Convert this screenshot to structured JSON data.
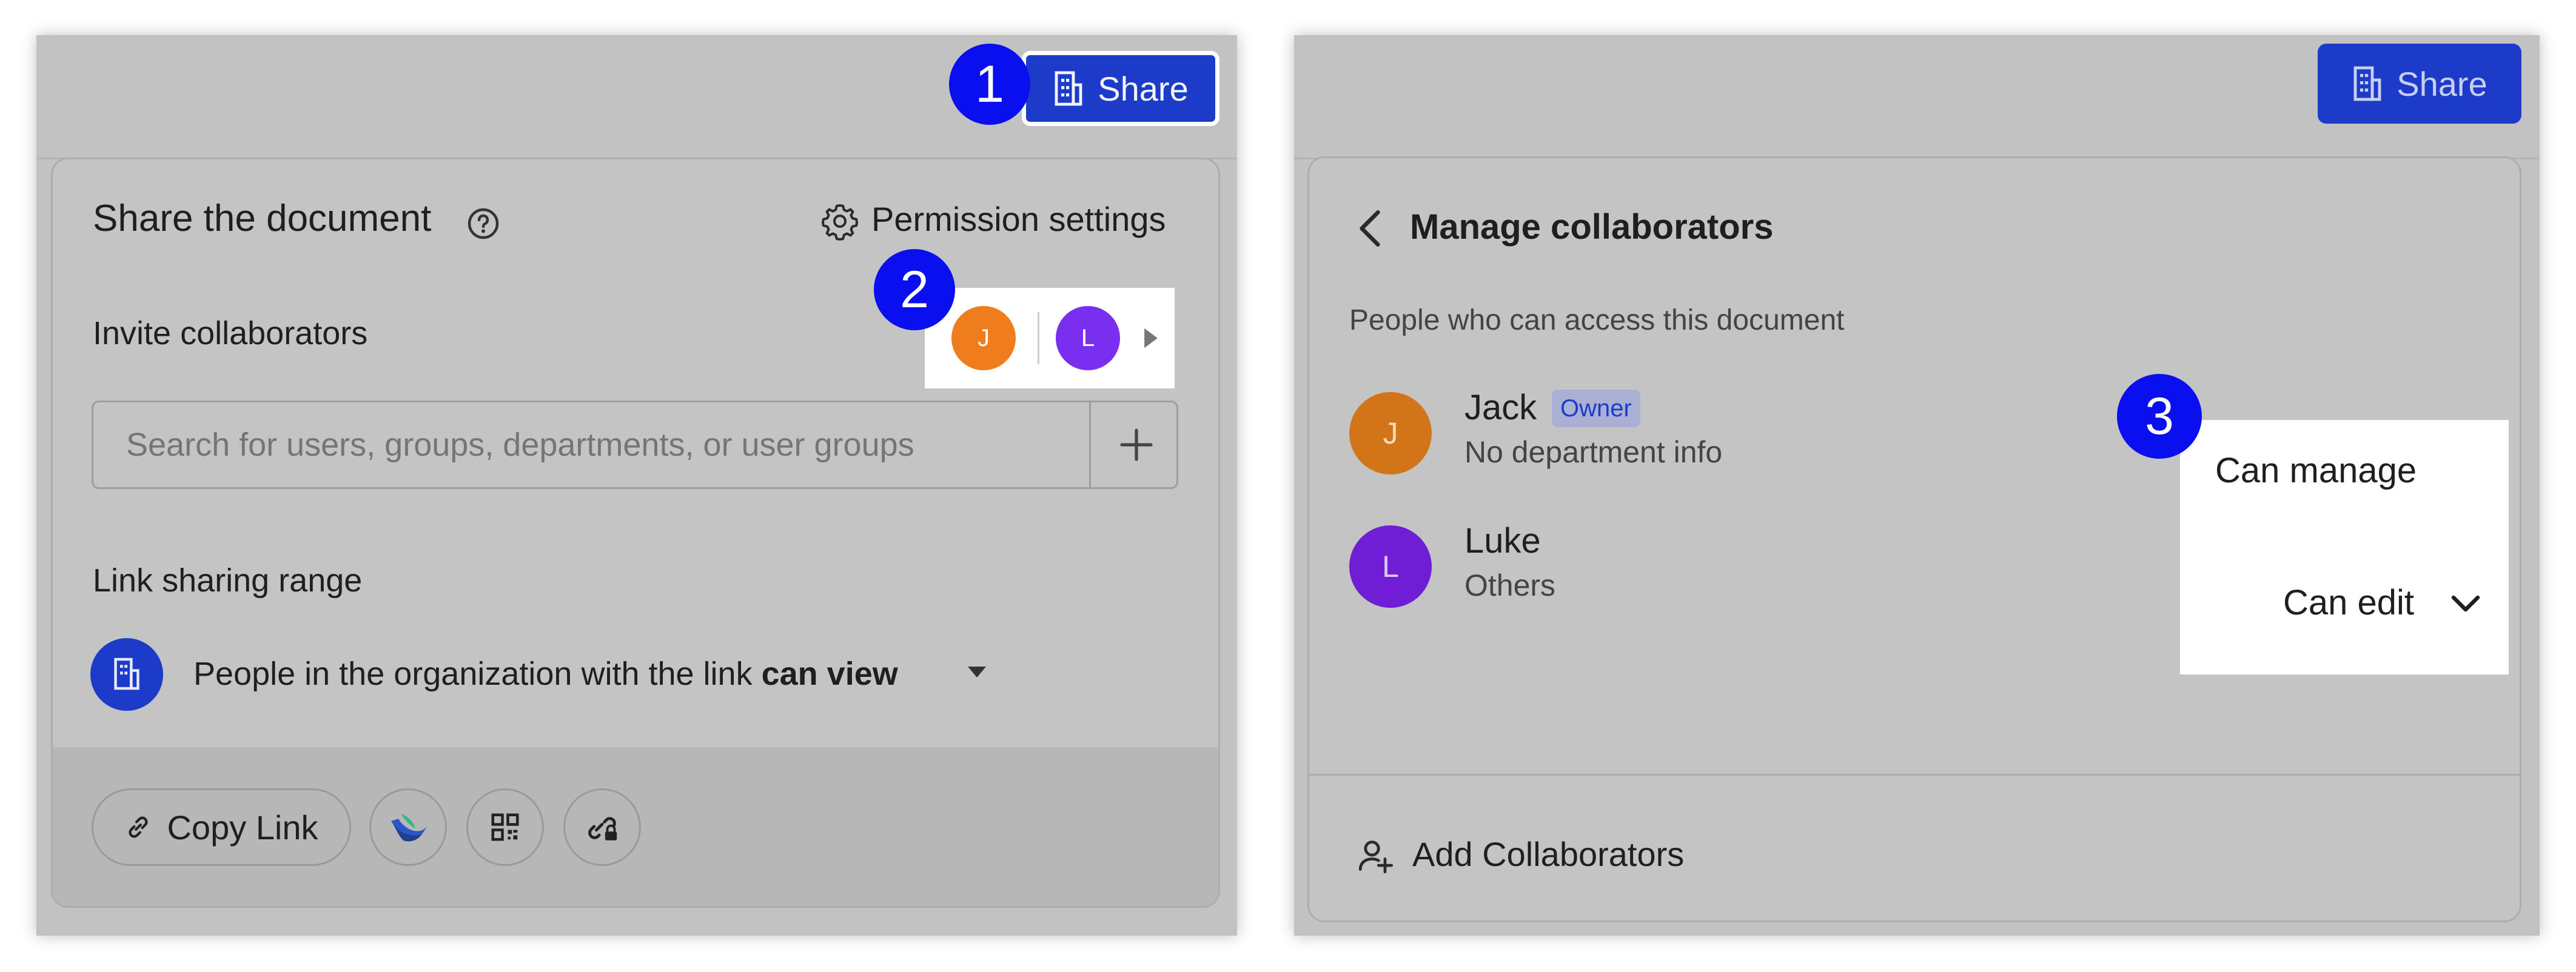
{
  "colors": {
    "accent": "#1c3bc9",
    "marker": "#0a0ff0",
    "jack_avatar": "#d27519",
    "luke_avatar": "#6f1ed6",
    "owner_badge_bg": "#a9b0d4",
    "owner_badge_text": "#1c3bc9"
  },
  "steps": [
    "1",
    "2",
    "3"
  ],
  "left": {
    "share_label": "Share",
    "share_icon": "building-icon",
    "title": "Share the document",
    "help_icon": "question-circle-icon",
    "permission_icon": "gear-icon",
    "permission_label": "Permission settings",
    "invite_label": "Invite collaborators",
    "avatars": [
      {
        "initial": "J",
        "color": "#ef7c1d"
      },
      {
        "initial": "L",
        "color": "#7a2ff0"
      }
    ],
    "avatars_more_icon": "caret-right-icon",
    "search_placeholder": "Search for users, groups, departments, or user groups",
    "add_icon": "plus-icon",
    "link_range_label": "Link sharing range",
    "org_icon": "building-icon",
    "link_text": "People in the organization with the link",
    "link_permission": "can view",
    "link_dropdown_icon": "caret-down-icon",
    "copy_link_label": "Copy Link",
    "copy_link_icon": "link-icon",
    "footer_icons": [
      "lark-icon",
      "qr-code-icon",
      "link-lock-icon"
    ]
  },
  "right": {
    "share_label": "Share",
    "back_icon": "chevron-left-icon",
    "title": "Manage collaborators",
    "access_label": "People who can access this document",
    "collaborators": [
      {
        "initial": "J",
        "name": "Jack",
        "badge": "Owner",
        "subtitle": "No department info",
        "permission": "Can manage"
      },
      {
        "initial": "L",
        "name": "Luke",
        "badge": "",
        "subtitle": "Others",
        "permission": "Can edit"
      }
    ],
    "permission_dropdown_icon": "chevron-down-icon",
    "add_collaborators_label": "Add Collaborators",
    "add_collaborators_icon": "add-user-icon"
  }
}
